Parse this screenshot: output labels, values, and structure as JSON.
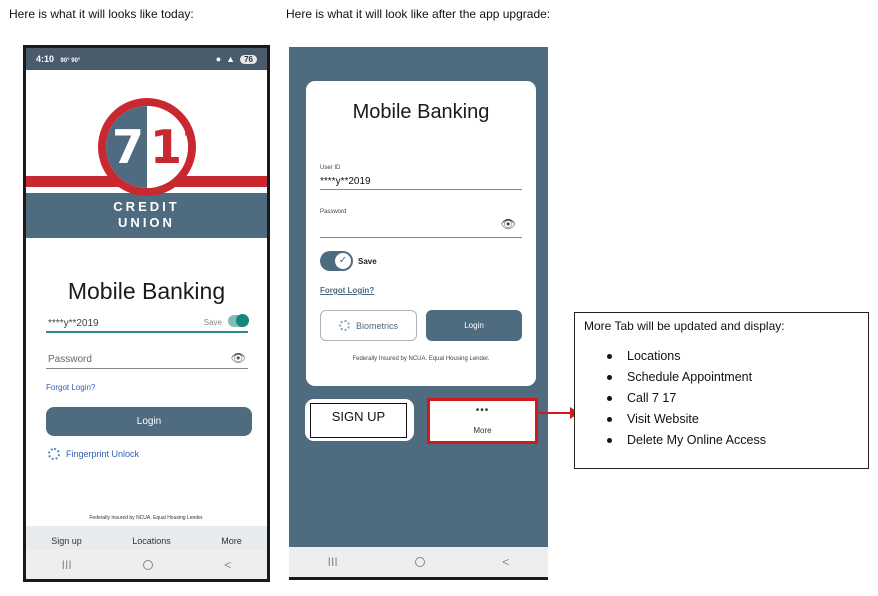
{
  "captions": {
    "today": "Here is what it will looks like today:",
    "after": "Here is what it will look like after the app upgrade:"
  },
  "phone_today": {
    "status": {
      "time": "4:10",
      "left_icons": "90° 90°",
      "battery": "76"
    },
    "logo": {
      "left_digit": "7",
      "right_digits": "17",
      "line1": "CREDIT",
      "line2": "UNION"
    },
    "title": "Mobile Banking",
    "user_id_value": "****y**2019",
    "save_label": "Save",
    "password_placeholder": "Password",
    "forgot_login": "Forgot Login?",
    "login_button": "Login",
    "fingerprint_unlock": "Fingerprint Unlock",
    "federal_notice": "Federally Insured by NCUA. Equal Housing Lender.",
    "tabs": [
      "Sign up",
      "Locations",
      "More"
    ],
    "nav": {
      "recents": "III",
      "back": "<"
    }
  },
  "phone_after": {
    "title": "Mobile Banking",
    "user_id_label": "User ID",
    "user_id_value": "****y**2019",
    "password_label": "Password",
    "save_label": "Save",
    "forgot_login": "Forgot Login?",
    "biometrics_button": "Biometrics",
    "login_button": "Login",
    "federal_notice": "Federally Insured by NCUA. Equal Housing Lender.",
    "signup_button": "SIGN UP",
    "more_dots": "•••",
    "more_label": "More",
    "nav": {
      "recents": "III",
      "back": "<"
    }
  },
  "more_tab_box": {
    "title": "More Tab will be updated and display:",
    "items": [
      "Locations",
      "Schedule Appointment",
      "Call 7 17",
      "Visit Website",
      "Delete My Online Access"
    ]
  },
  "colors": {
    "slate": "#4e6b80",
    "brand_red": "#c9282f",
    "highlight_red": "#d11a1a",
    "teal": "#16857b",
    "link_blue": "#2c5fb3"
  }
}
